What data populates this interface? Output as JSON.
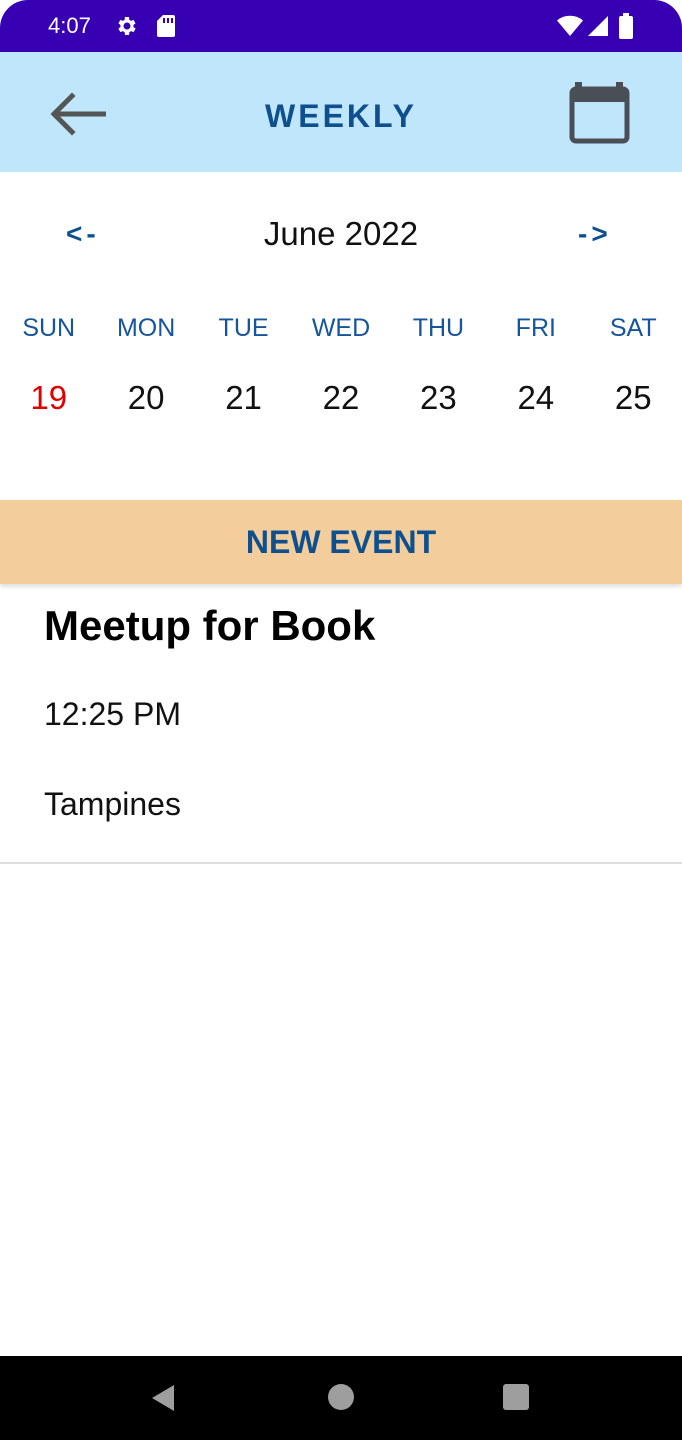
{
  "status_bar": {
    "time": "4:07",
    "icons": [
      "gear-icon",
      "sd-card-icon",
      "wifi-icon",
      "signal-icon",
      "battery-icon"
    ],
    "background_color": "#3800b3"
  },
  "app_bar": {
    "title": "WEEKLY",
    "back_icon": "arrow-left-icon",
    "calendar_icon": "calendar-icon",
    "background_color": "#bfe6fb",
    "title_color": "#0e4f8e"
  },
  "calendar": {
    "prev_label": "<-",
    "next_label": "->",
    "month_label": "June 2022",
    "weekdays": [
      "SUN",
      "MON",
      "TUE",
      "WED",
      "THU",
      "FRI",
      "SAT"
    ],
    "dates": [
      "19",
      "20",
      "21",
      "22",
      "23",
      "24",
      "25"
    ],
    "sunday_color": "#e10000"
  },
  "new_event": {
    "label": "NEW EVENT",
    "background_color": "#f4cd9c"
  },
  "events": [
    {
      "title": "Meetup for Book",
      "time": "12:25 PM",
      "location": "Tampines"
    }
  ],
  "nav_bar": {
    "icons": [
      "back-triangle-icon",
      "home-circle-icon",
      "recents-square-icon"
    ]
  }
}
